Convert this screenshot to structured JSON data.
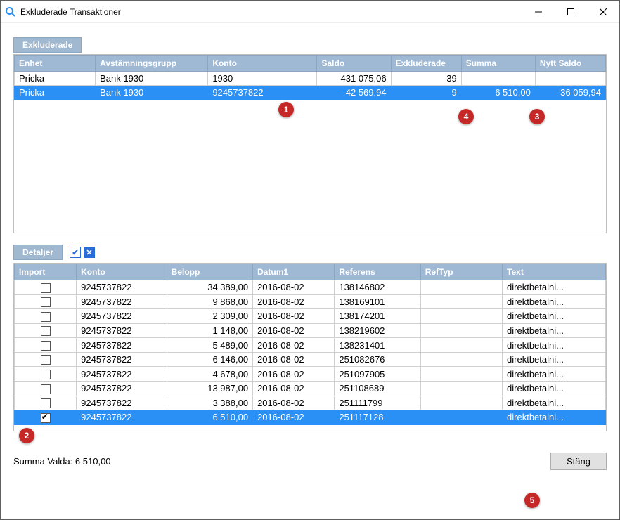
{
  "window": {
    "title": "Exkluderade Transaktioner"
  },
  "tabs": {
    "exkluderade": "Exkluderade",
    "detaljer": "Detaljer"
  },
  "summary": {
    "headers": [
      "Enhet",
      "Avstämningsgrupp",
      "Konto",
      "Saldo",
      "Exkluderade",
      "Summa",
      "Nytt Saldo"
    ],
    "rows": [
      {
        "enhet": "Pricka",
        "grupp": "Bank 1930",
        "konto": "1930",
        "saldo": "431 075,06",
        "exkl": "39",
        "summa": "",
        "nytt": "",
        "selected": false
      },
      {
        "enhet": "Pricka",
        "grupp": "Bank 1930",
        "konto": "9245737822",
        "saldo": "-42 569,94",
        "exkl": "9",
        "summa": "6 510,00",
        "nytt": "-36 059,94",
        "selected": true
      }
    ]
  },
  "details": {
    "headers": [
      "Import",
      "Konto",
      "Belopp",
      "Datum1",
      "Referens",
      "RefTyp",
      "Text"
    ],
    "rows": [
      {
        "import": false,
        "konto": "9245737822",
        "belopp": "34 389,00",
        "datum": "2016-08-02",
        "ref": "138146802",
        "reftyp": "",
        "text": "direktbetalni..."
      },
      {
        "import": false,
        "konto": "9245737822",
        "belopp": "9 868,00",
        "datum": "2016-08-02",
        "ref": "138169101",
        "reftyp": "",
        "text": "direktbetalni..."
      },
      {
        "import": false,
        "konto": "9245737822",
        "belopp": "2 309,00",
        "datum": "2016-08-02",
        "ref": "138174201",
        "reftyp": "",
        "text": "direktbetalni..."
      },
      {
        "import": false,
        "konto": "9245737822",
        "belopp": "1 148,00",
        "datum": "2016-08-02",
        "ref": "138219602",
        "reftyp": "",
        "text": "direktbetalni..."
      },
      {
        "import": false,
        "konto": "9245737822",
        "belopp": "5 489,00",
        "datum": "2016-08-02",
        "ref": "138231401",
        "reftyp": "",
        "text": "direktbetalni..."
      },
      {
        "import": false,
        "konto": "9245737822",
        "belopp": "6 146,00",
        "datum": "2016-08-02",
        "ref": "251082676",
        "reftyp": "",
        "text": "direktbetalni..."
      },
      {
        "import": false,
        "konto": "9245737822",
        "belopp": "4 678,00",
        "datum": "2016-08-02",
        "ref": "251097905",
        "reftyp": "",
        "text": "direktbetalni..."
      },
      {
        "import": false,
        "konto": "9245737822",
        "belopp": "13 987,00",
        "datum": "2016-08-02",
        "ref": "251108689",
        "reftyp": "",
        "text": "direktbetalni..."
      },
      {
        "import": false,
        "konto": "9245737822",
        "belopp": "3 388,00",
        "datum": "2016-08-02",
        "ref": "251111799",
        "reftyp": "",
        "text": "direktbetalni..."
      },
      {
        "import": true,
        "konto": "9245737822",
        "belopp": "6 510,00",
        "datum": "2016-08-02",
        "ref": "251117128",
        "reftyp": "",
        "text": "direktbetalni...",
        "selected": true
      }
    ]
  },
  "footer": {
    "summa_valda_label": "Summa Valda: ",
    "summa_valda_value": "6 510,00",
    "close_label": "Stäng"
  },
  "annotations": {
    "b1": "1",
    "b2": "2",
    "b3": "3",
    "b4": "4",
    "b5": "5"
  }
}
